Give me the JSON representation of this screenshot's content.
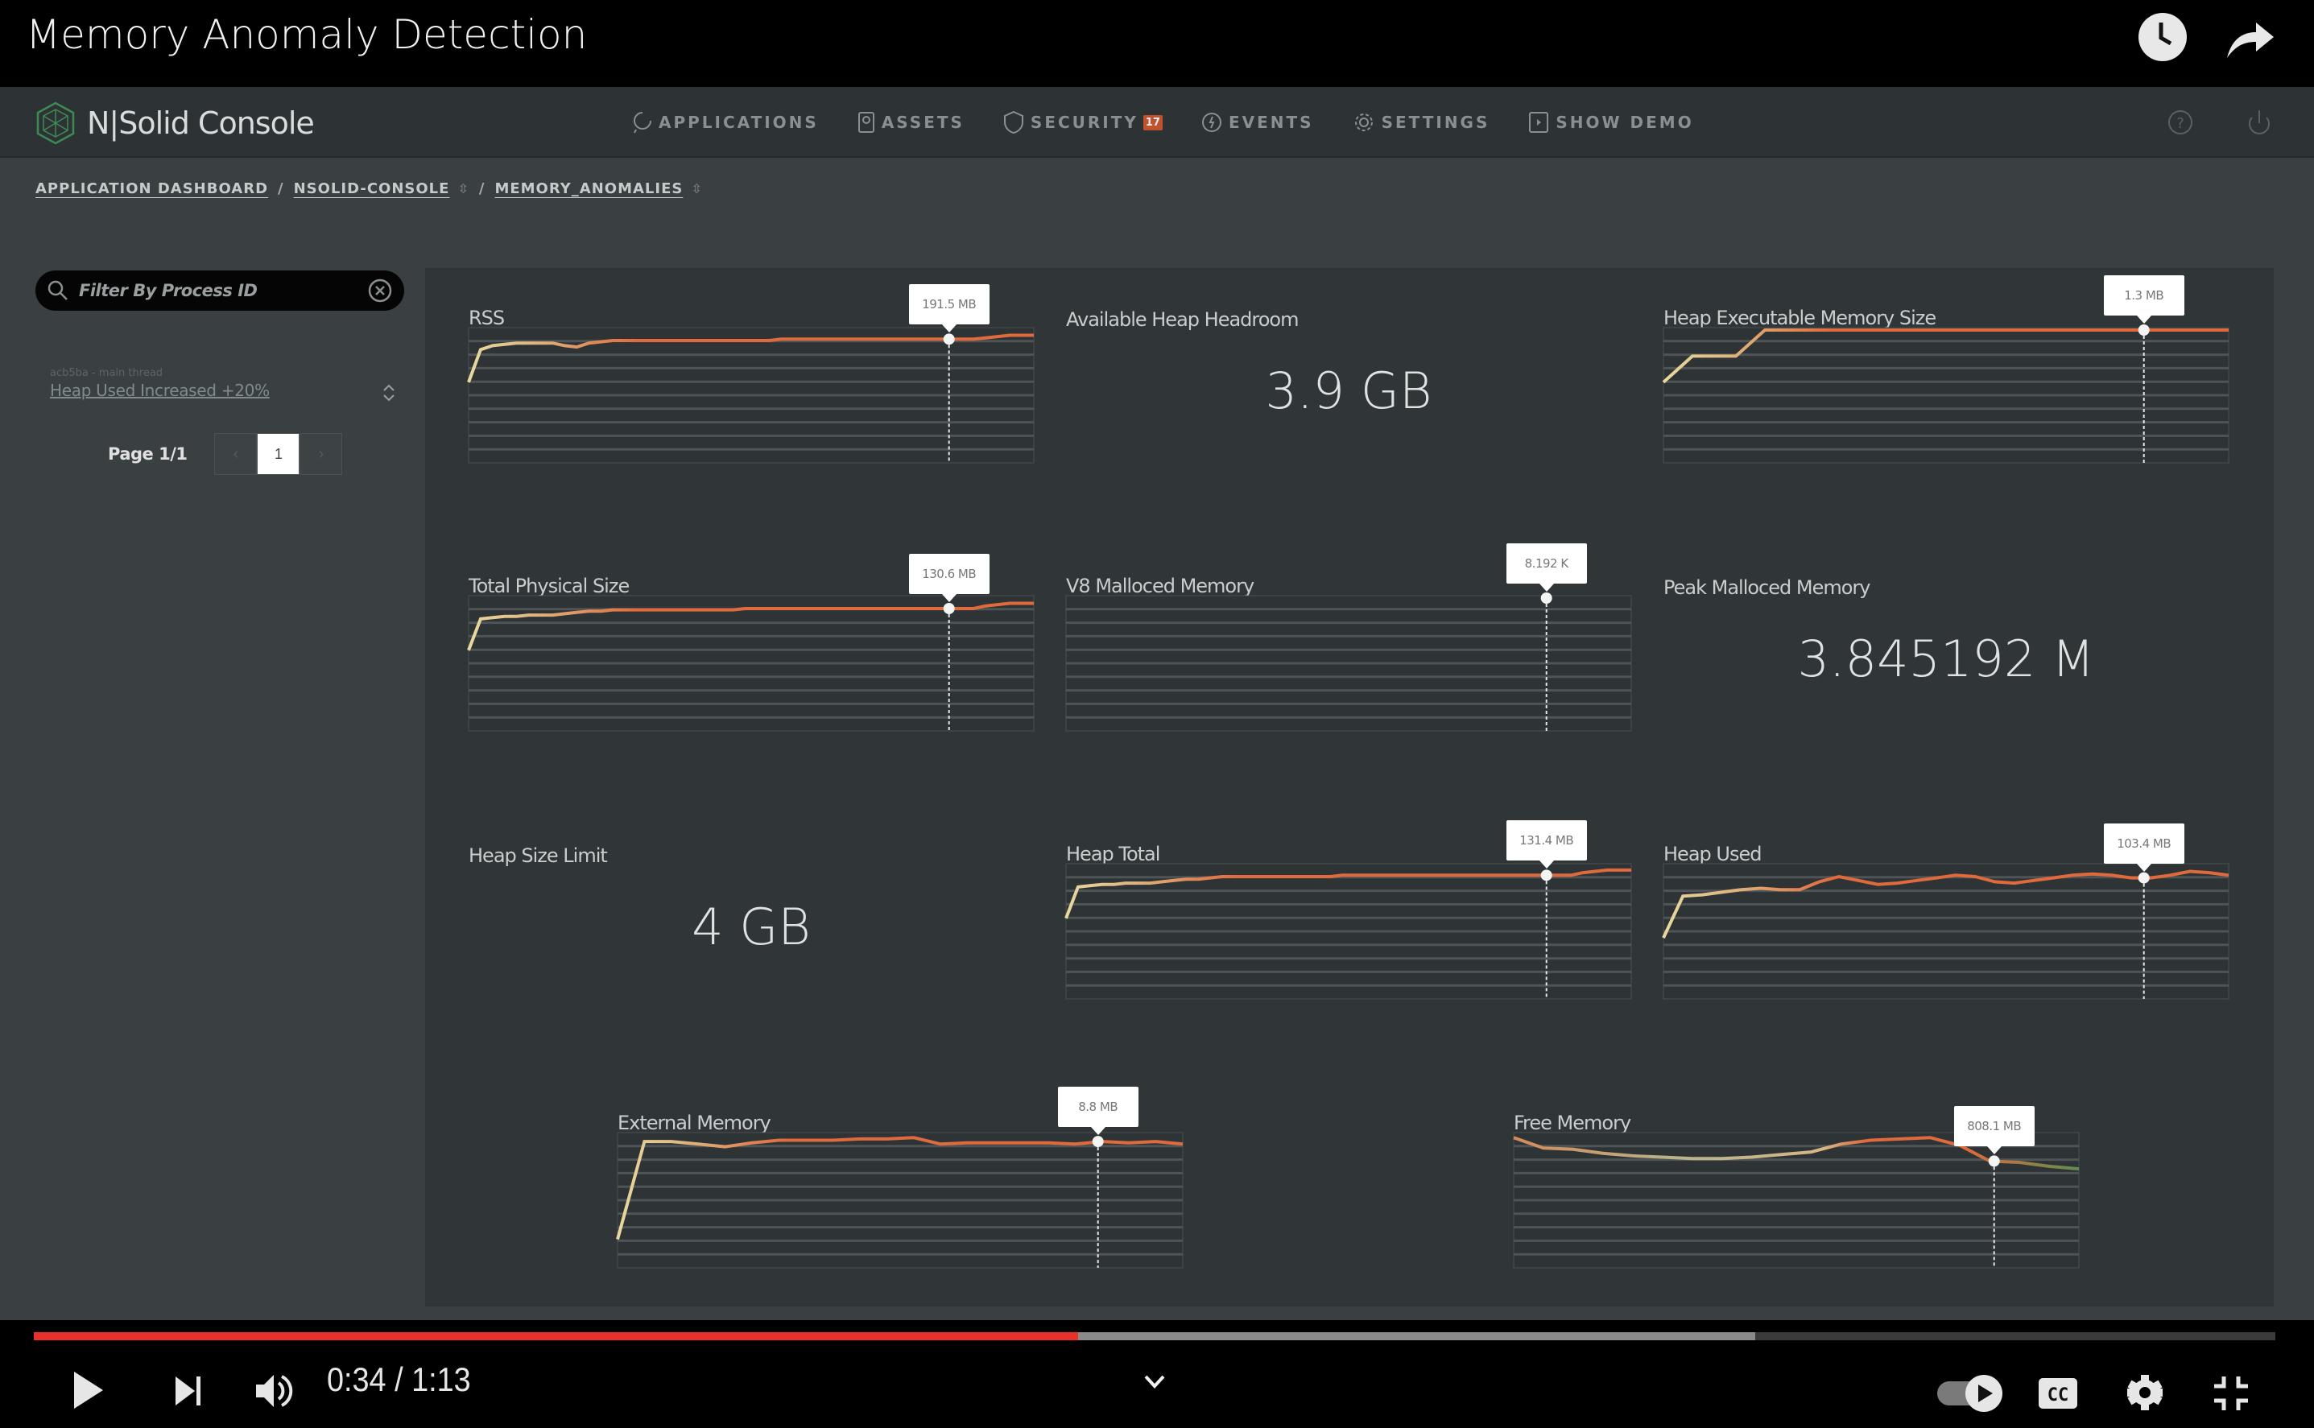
{
  "video": {
    "title": "Memory Anomaly Detection",
    "top_icons": [
      "watch-later-icon",
      "share-icon"
    ],
    "current_time": "0:34",
    "duration": "1:13",
    "time_display": "0:34 / 1:13",
    "played_fraction": 0.466,
    "buffered_fraction": 0.768,
    "progress_color": "#e8312a"
  },
  "app": {
    "logo_text": "N|Solid Console",
    "logo_color": "#3e8a55",
    "nav": [
      {
        "label": "APPLICATIONS",
        "icon": "applications-icon"
      },
      {
        "label": "ASSETS",
        "icon": "assets-icon"
      },
      {
        "label": "SECURITY",
        "icon": "shield-icon",
        "badge": "17"
      },
      {
        "label": "EVENTS",
        "icon": "events-icon"
      },
      {
        "label": "SETTINGS",
        "icon": "gear-icon"
      },
      {
        "label": "SHOW DEMO",
        "icon": "demo-icon"
      }
    ],
    "header_icons": [
      "help-icon",
      "power-icon"
    ],
    "breadcrumb": [
      "APPLICATION DASHBOARD",
      "NSOLID-CONSOLE",
      "MEMORY_ANOMALIES"
    ],
    "accent": "#e06a3c"
  },
  "sidebar": {
    "filter_placeholder": "Filter By Process ID",
    "filter_value": "",
    "anomaly": {
      "subtitle": "acb5ba - main thread",
      "label": "Heap Used Increased +20%"
    },
    "pager": {
      "label": "Page 1/1",
      "current": "1",
      "prev": "‹",
      "next": "›"
    }
  },
  "stats": [
    {
      "title": "Available Heap Headroom",
      "value": "3.9 GB"
    },
    {
      "title": "Peak Malloced Memory",
      "value": "3.845192 M"
    },
    {
      "title": "Heap Size Limit",
      "value": "4 GB"
    }
  ],
  "chart_data": [
    {
      "type": "line",
      "title": "RSS",
      "tooltip": "191.5 MB",
      "hover_fraction": 0.85,
      "ylim": [
        0,
        1
      ],
      "values": [
        0.6,
        0.85,
        0.88,
        0.89,
        0.9,
        0.9,
        0.9,
        0.9,
        0.88,
        0.87,
        0.9,
        0.91,
        0.92,
        0.92,
        0.92,
        0.92,
        0.92,
        0.92,
        0.92,
        0.92,
        0.92,
        0.92,
        0.92,
        0.92,
        0.92,
        0.92,
        0.93,
        0.93,
        0.93,
        0.93,
        0.93,
        0.93,
        0.93,
        0.93,
        0.93,
        0.93,
        0.93,
        0.93,
        0.93,
        0.93,
        0.93,
        0.93,
        0.93,
        0.94,
        0.95,
        0.96,
        0.96,
        0.96
      ]
    },
    {
      "type": "line",
      "title": "Heap Executable Memory Size",
      "tooltip": "1.3 MB",
      "hover_fraction": 0.85,
      "ylim": [
        0,
        1
      ],
      "values": [
        0.6,
        0.7,
        0.8,
        0.8,
        0.8,
        0.8,
        0.9,
        1.0,
        1.0,
        1.0,
        1.0,
        1.0,
        1.0,
        1.0,
        1.0,
        1.0,
        1.0,
        1.0,
        1.0,
        1.0,
        1.0,
        1.0,
        1.0,
        1.0,
        1.0,
        1.0,
        1.0,
        1.0,
        1.0,
        1.0,
        1.0,
        1.0,
        1.0,
        1.0,
        1.0,
        1.0,
        1.0,
        1.0,
        1.0,
        1.0
      ]
    },
    {
      "type": "line",
      "title": "Total Physical Size",
      "tooltip": "130.6 MB",
      "hover_fraction": 0.85,
      "ylim": [
        0,
        1
      ],
      "values": [
        0.6,
        0.84,
        0.85,
        0.86,
        0.86,
        0.87,
        0.87,
        0.87,
        0.88,
        0.89,
        0.9,
        0.9,
        0.91,
        0.91,
        0.91,
        0.91,
        0.91,
        0.91,
        0.91,
        0.91,
        0.91,
        0.91,
        0.91,
        0.92,
        0.92,
        0.92,
        0.92,
        0.92,
        0.92,
        0.92,
        0.92,
        0.92,
        0.92,
        0.92,
        0.92,
        0.92,
        0.92,
        0.92,
        0.92,
        0.92,
        0.92,
        0.92,
        0.92,
        0.94,
        0.95,
        0.96,
        0.96,
        0.96
      ]
    },
    {
      "type": "line",
      "title": "V8 Malloced Memory",
      "tooltip": "8.192 K",
      "hover_fraction": 0.85,
      "ylim": [
        0,
        1
      ],
      "values": [
        1,
        1,
        1,
        1,
        1,
        1,
        1,
        1,
        1,
        1
      ]
    },
    {
      "type": "line",
      "title": "Heap Total",
      "tooltip": "131.4 MB",
      "hover_fraction": 0.85,
      "ylim": [
        0,
        1
      ],
      "values": [
        0.6,
        0.84,
        0.85,
        0.86,
        0.86,
        0.87,
        0.87,
        0.87,
        0.88,
        0.89,
        0.9,
        0.9,
        0.91,
        0.92,
        0.92,
        0.92,
        0.92,
        0.92,
        0.92,
        0.92,
        0.92,
        0.92,
        0.92,
        0.93,
        0.93,
        0.93,
        0.93,
        0.93,
        0.93,
        0.93,
        0.93,
        0.93,
        0.93,
        0.93,
        0.93,
        0.93,
        0.93,
        0.93,
        0.93,
        0.93,
        0.93,
        0.93,
        0.93,
        0.95,
        0.96,
        0.97,
        0.97,
        0.97
      ]
    },
    {
      "type": "line",
      "title": "Heap Used",
      "tooltip": "103.4 MB",
      "hover_fraction": 0.85,
      "ylim": [
        0,
        1
      ],
      "values": [
        0.45,
        0.77,
        0.78,
        0.8,
        0.82,
        0.83,
        0.82,
        0.82,
        0.88,
        0.92,
        0.89,
        0.86,
        0.87,
        0.89,
        0.91,
        0.93,
        0.92,
        0.88,
        0.87,
        0.89,
        0.91,
        0.93,
        0.94,
        0.93,
        0.91,
        0.91,
        0.93,
        0.96,
        0.95,
        0.93
      ]
    },
    {
      "type": "line",
      "title": "External Memory",
      "tooltip": "8.8 MB",
      "hover_fraction": 0.85,
      "ylim": [
        0,
        1
      ],
      "values": [
        0.2,
        0.95,
        0.95,
        0.93,
        0.91,
        0.94,
        0.96,
        0.96,
        0.96,
        0.97,
        0.97,
        0.98,
        0.93,
        0.94,
        0.94,
        0.94,
        0.94,
        0.93,
        0.95,
        0.94,
        0.95,
        0.93
      ]
    },
    {
      "type": "line",
      "title": "Free Memory",
      "tooltip": "808.1 MB",
      "hover_fraction": 0.85,
      "ylim": [
        0,
        1
      ],
      "values": [
        0.98,
        0.9,
        0.89,
        0.86,
        0.84,
        0.83,
        0.82,
        0.82,
        0.83,
        0.85,
        0.87,
        0.93,
        0.96,
        0.97,
        0.98,
        0.92,
        0.8,
        0.79,
        0.76,
        0.74
      ]
    }
  ]
}
